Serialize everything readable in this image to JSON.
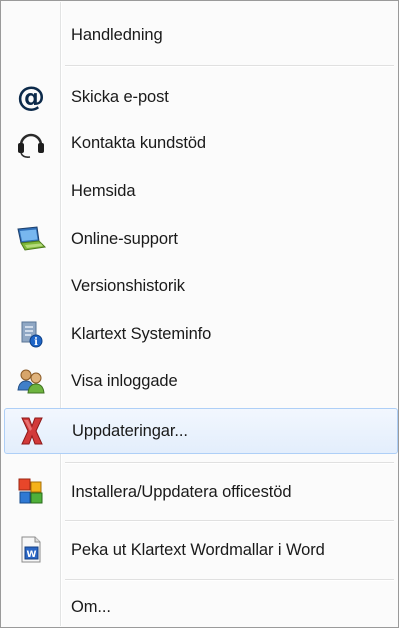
{
  "menu": {
    "items": [
      {
        "label": "Handledning",
        "icon": "none"
      },
      {
        "label": "Skicka e-post",
        "icon": "at-sign-icon"
      },
      {
        "label": "Kontakta kundstöd",
        "icon": "headset-icon"
      },
      {
        "label": "Hemsida",
        "icon": "none"
      },
      {
        "label": "Online-support",
        "icon": "laptop-icon"
      },
      {
        "label": "Versionshistorik",
        "icon": "none"
      },
      {
        "label": "Klartext Systeminfo",
        "icon": "document-info-icon"
      },
      {
        "label": "Visa inloggade",
        "icon": "users-icon"
      },
      {
        "label": "Uppdateringar...",
        "icon": "red-x-icon"
      },
      {
        "label": "Installera/Uppdatera officestöd",
        "icon": "office-icon"
      },
      {
        "label": "Peka ut Klartext Wordmallar i Word",
        "icon": "word-document-icon"
      },
      {
        "label": "Om...",
        "icon": "none"
      }
    ],
    "highlighted_item": "Uppdateringar...",
    "colors": {
      "highlight_border": "#aecff7",
      "highlight_fill": "#e8f1fd",
      "text": "#1a1a1a"
    }
  }
}
